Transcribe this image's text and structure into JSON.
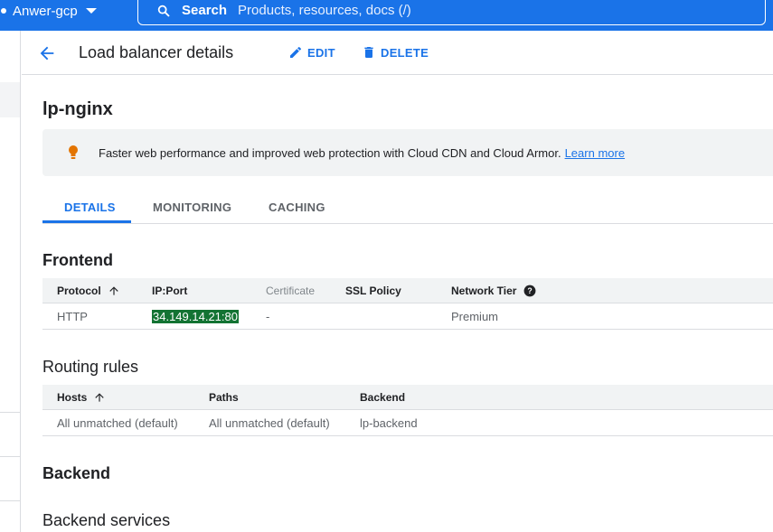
{
  "topbar": {
    "project": "Anwer-gcp",
    "search_label": "Search",
    "search_placeholder": "Products, resources, docs (/)"
  },
  "header": {
    "title": "Load balancer details",
    "edit_label": "EDIT",
    "delete_label": "DELETE"
  },
  "lb_name": "lp-nginx",
  "banner": {
    "text": "Faster web performance and improved web protection with Cloud CDN and Cloud Armor.",
    "link": "Learn more"
  },
  "tabs": [
    "DETAILS",
    "MONITORING",
    "CACHING"
  ],
  "frontend": {
    "title": "Frontend",
    "headers": [
      "Protocol",
      "IP:Port",
      "Certificate",
      "SSL Policy",
      "Network Tier"
    ],
    "row": [
      "HTTP",
      "34.149.14.21:80",
      "-",
      "",
      "Premium"
    ]
  },
  "routing": {
    "title": "Routing rules",
    "headers": [
      "Hosts",
      "Paths",
      "Backend"
    ],
    "row": [
      "All unmatched (default)",
      "All unmatched (default)",
      "lp-backend"
    ]
  },
  "backend": {
    "title": "Backend",
    "services_title": "Backend services"
  },
  "colors": {
    "primary": "#1a73e8",
    "highlight": "#137333",
    "bulb": "#e37400"
  }
}
